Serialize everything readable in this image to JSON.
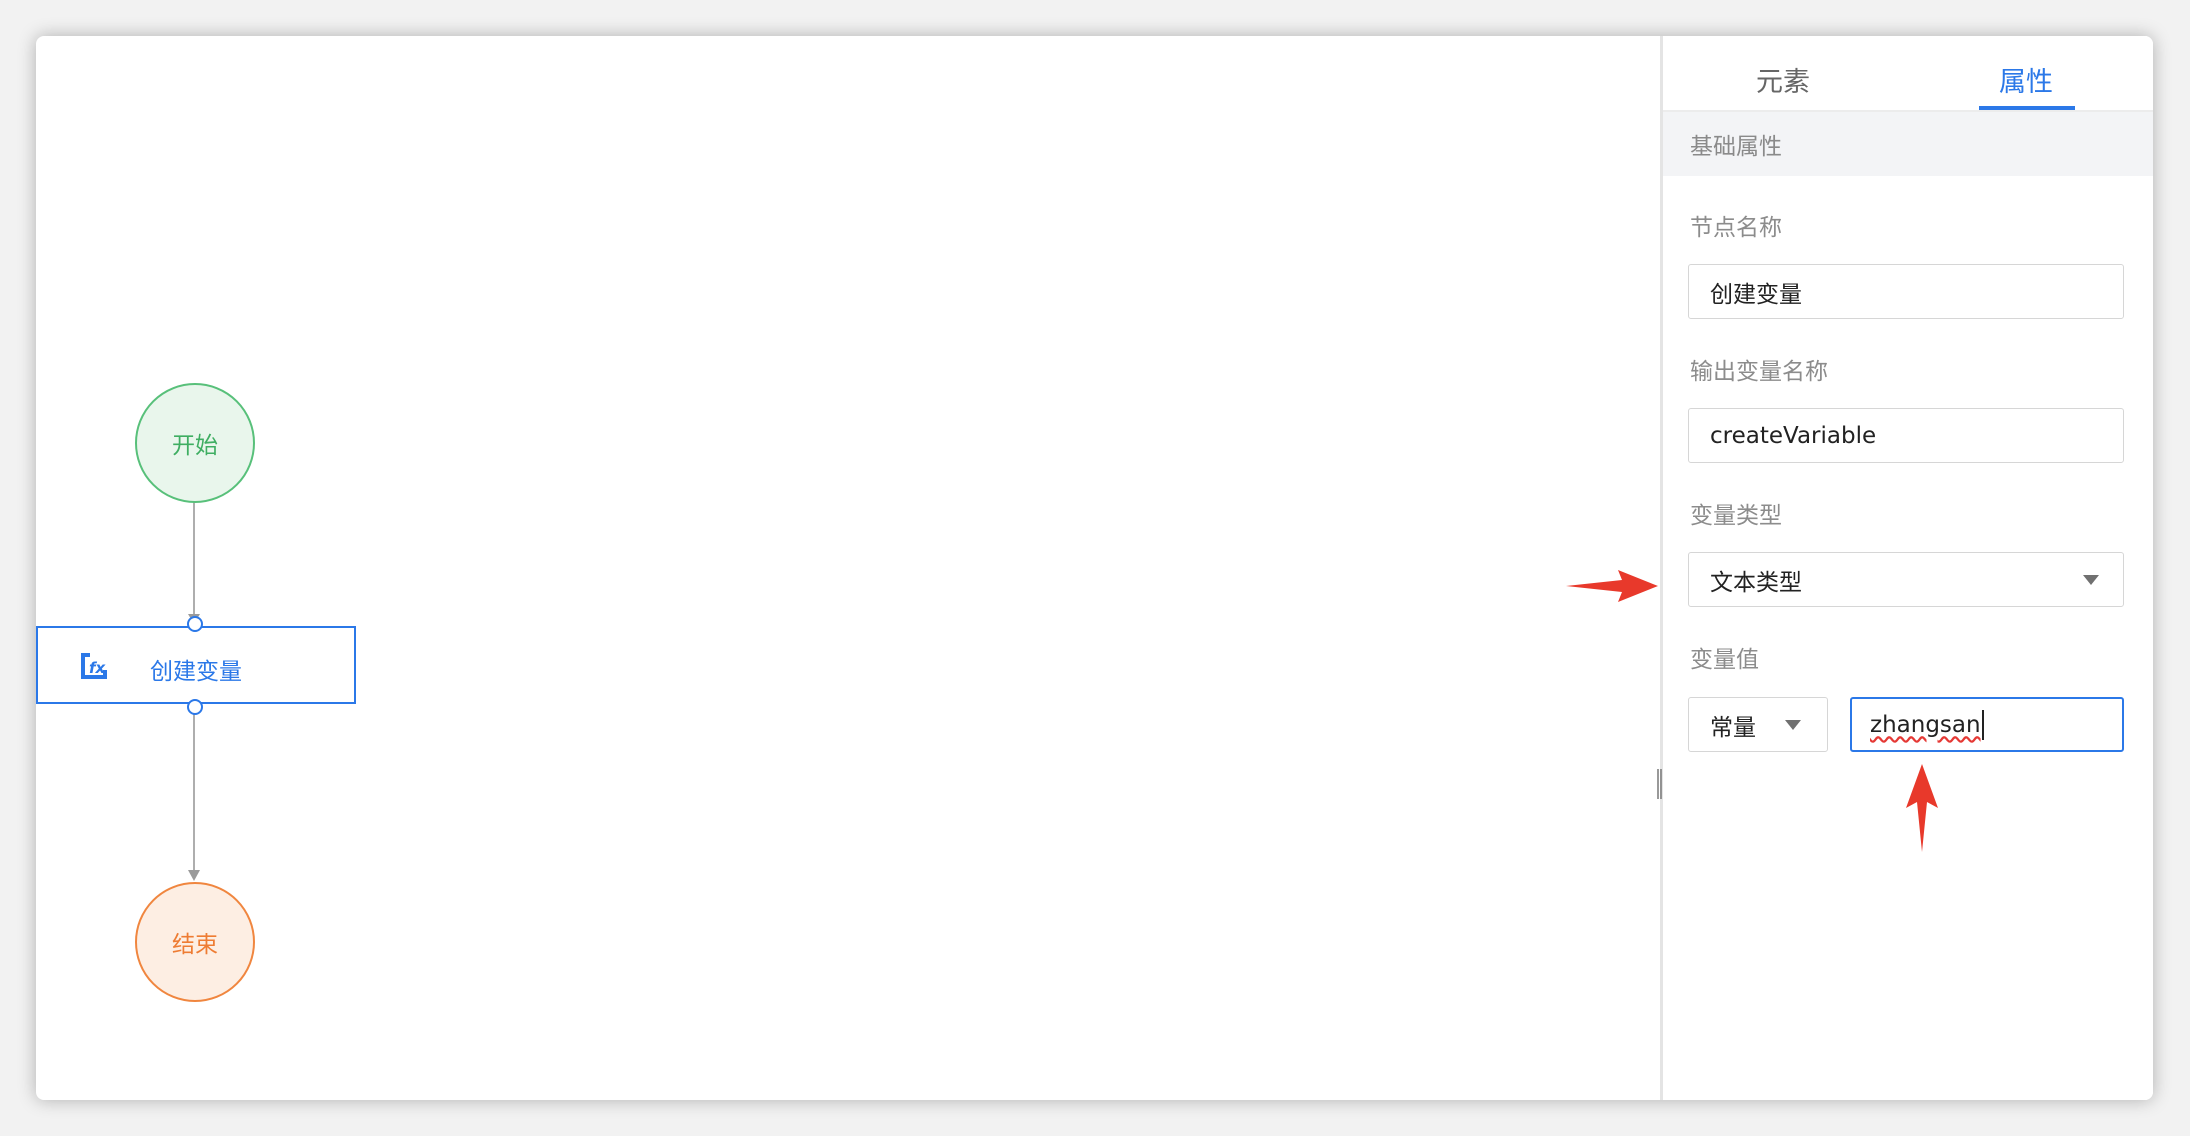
{
  "canvas": {
    "start_label": "开始",
    "task_label": "创建变量",
    "end_label": "结束"
  },
  "panel": {
    "tabs": [
      {
        "label": "元素",
        "active": false
      },
      {
        "label": "属性",
        "active": true
      }
    ],
    "section_title": "基础属性",
    "node_name_label": "节点名称",
    "node_name_value": "创建变量",
    "output_var_label": "输出变量名称",
    "output_var_value": "createVariable",
    "var_type_label": "变量类型",
    "var_type_value": "文本类型",
    "var_value_label": "变量值",
    "value_source": "常量",
    "value_text": "zhangsan"
  },
  "colors": {
    "accent": "#2b78e8",
    "start": "#58c07a",
    "end": "#f0863f",
    "annotation_arrow": "#e8392b"
  }
}
